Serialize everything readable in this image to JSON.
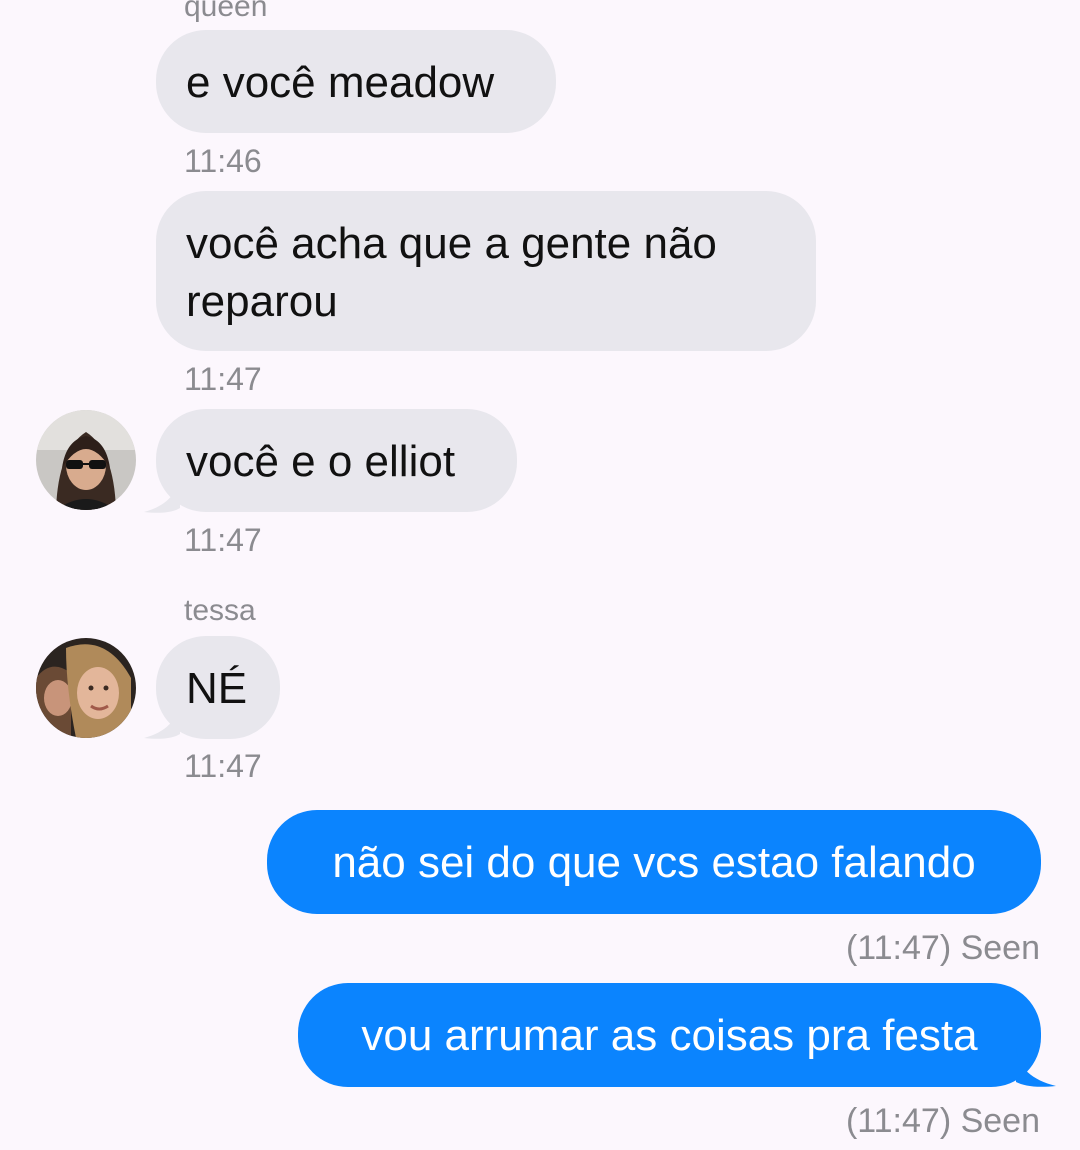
{
  "conversation": {
    "messages": [
      {
        "sender": "queen",
        "text": "e você meadow",
        "time": "11:46"
      },
      {
        "text": "você acha que a gente não reparou",
        "time": "11:47"
      },
      {
        "text": "você e o elliot",
        "time": "11:47"
      },
      {
        "sender": "tessa",
        "text": "NÉ",
        "time": "11:47"
      },
      {
        "text": "não sei do que vcs estao falando",
        "status": "(11:47) Seen"
      },
      {
        "text": "vou arrumar as coisas pra festa",
        "status": "(11:47) Seen"
      }
    ],
    "avatars": {
      "queen": "avatar-queen",
      "tessa": "avatar-tessa"
    },
    "colors": {
      "background": "#fcf7fd",
      "incoming_bubble": "#e8e7ed",
      "outgoing_bubble": "#0b84fe",
      "meta_text": "#8b8b90"
    }
  }
}
